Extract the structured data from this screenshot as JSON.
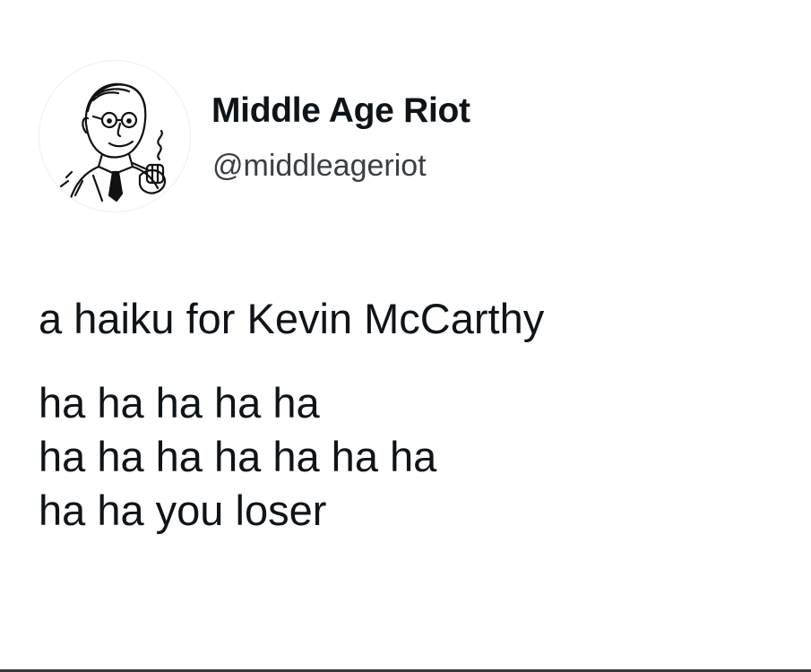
{
  "author": {
    "display_name": "Middle Age Riot",
    "handle": "@middleageriot",
    "avatar_icon": "man-with-pipe-avatar-icon"
  },
  "tweet": {
    "intro": "a haiku for Kevin McCarthy",
    "lines": [
      "ha ha ha ha ha",
      "ha ha ha ha ha ha ha",
      "ha ha you loser"
    ]
  }
}
